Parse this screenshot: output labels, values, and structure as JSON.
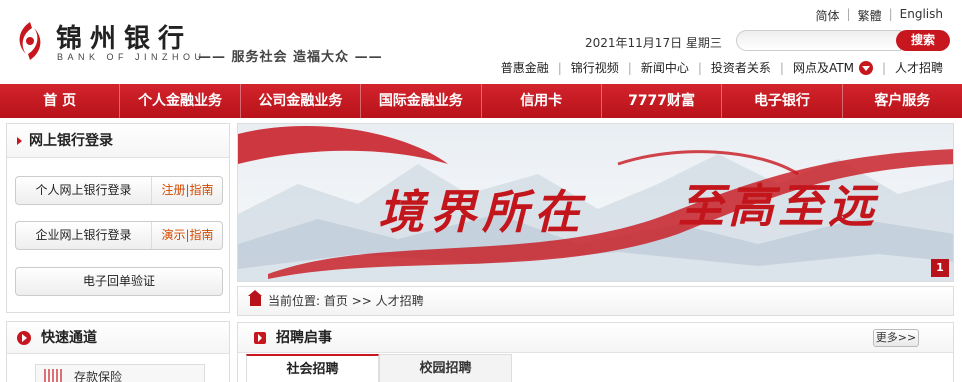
{
  "logo": {
    "cn": "锦州银行",
    "en": "BANK OF JINZHOU",
    "slogan": "—— 服务社会  造福大众 ——"
  },
  "lang": [
    "简体",
    "繁體",
    "English"
  ],
  "date": "2021年11月17日  星期三",
  "search": {
    "placeholder": "",
    "button": "搜索"
  },
  "quick_links": [
    "普惠金融",
    "锦行视频",
    "新闻中心",
    "投资者关系",
    "网点及ATM",
    "人才招聘"
  ],
  "nav": [
    "首  页",
    "个人金融业务",
    "公司金融业务",
    "国际金融业务",
    "信用卡",
    "7777财富",
    "电子银行",
    "客户服务"
  ],
  "login": {
    "title": "网上银行登录",
    "personal": {
      "label": "个人网上银行登录",
      "extra": "注册|指南"
    },
    "corporate": {
      "label": "企业网上银行登录",
      "extra": "演示|指南"
    },
    "receipt": "电子回单验证"
  },
  "fast": {
    "title": "快速通道",
    "item": "存款保险"
  },
  "banner": {
    "text1": "境界所在",
    "text2": "至高至远",
    "page": "1"
  },
  "breadcrumb": {
    "prefix": "当前位置:",
    "home": "首页",
    "sep": ">>",
    "current": "人才招聘"
  },
  "recruit": {
    "title": "招聘启事",
    "more": "更多>>",
    "tabs": [
      "社会招聘",
      "校园招聘"
    ]
  },
  "colors": {
    "brand_red": "#c8161e"
  }
}
